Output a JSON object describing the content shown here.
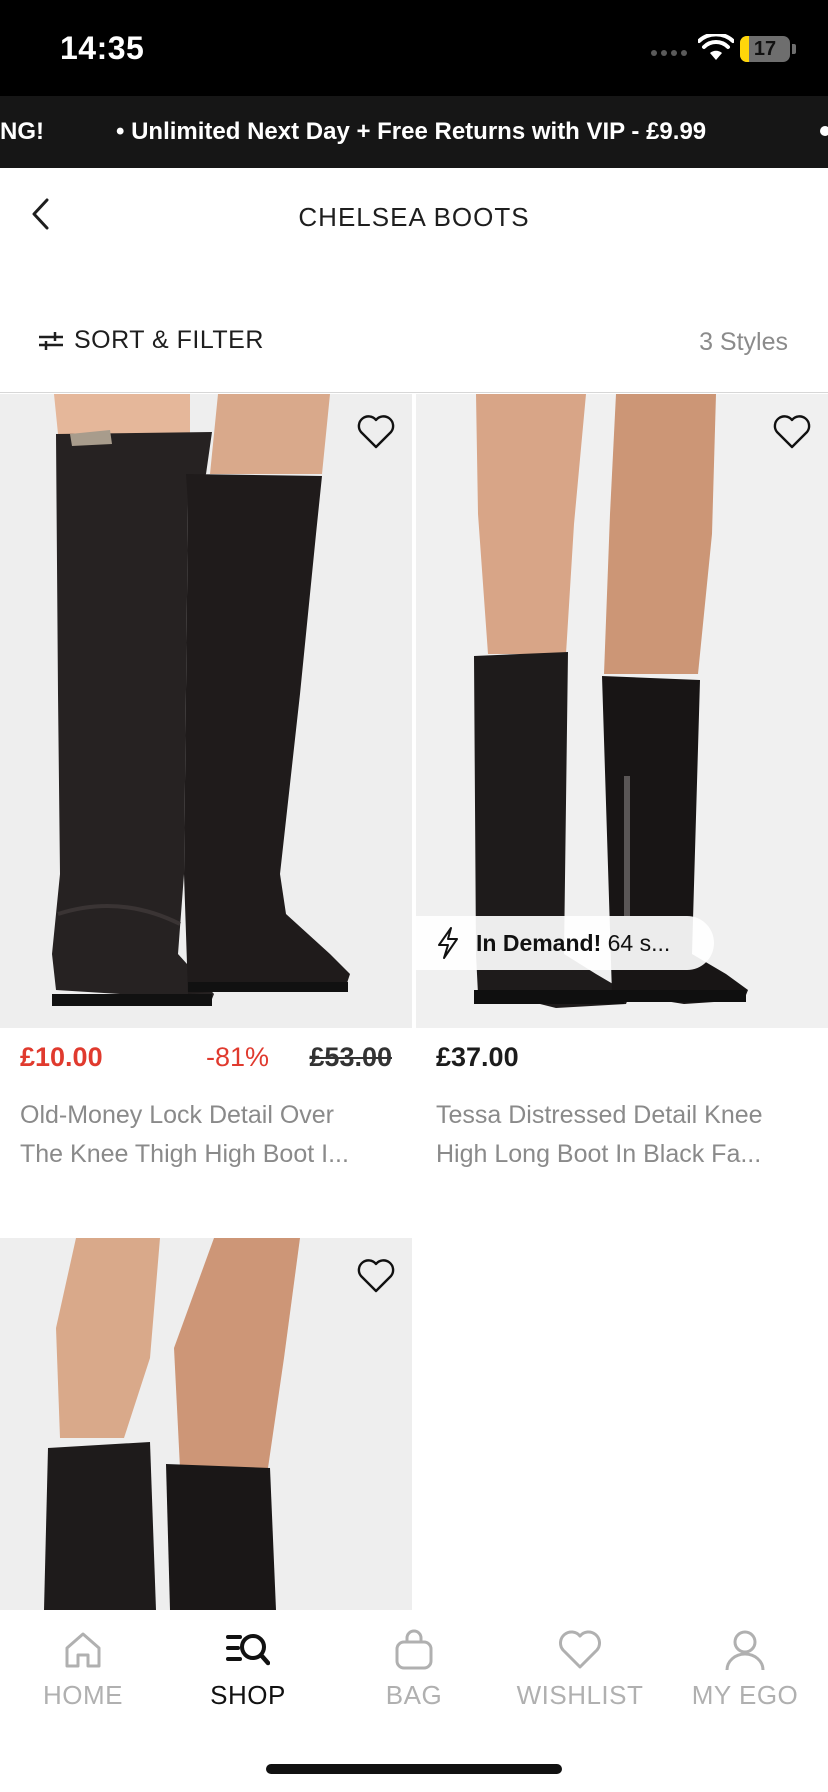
{
  "status_bar": {
    "time": "14:35",
    "battery": "17",
    "battery_level": 0.17
  },
  "promo": {
    "left_fragment": "NG!",
    "message": "• Unlimited Next Day + Free Returns with VIP - £9.99"
  },
  "header": {
    "title": "CHELSEA BOOTS",
    "back_icon": "chevron-left-icon"
  },
  "filter": {
    "label": "SORT & FILTER",
    "icon": "sliders-icon",
    "count": "3 Styles"
  },
  "products": [
    {
      "price": "£10.00",
      "discount": "-81%",
      "was_price": "£53.00",
      "name_line1": "Old-Money Lock Detail Over",
      "name_line2": "The Knee Thigh High Boot I...",
      "wishlist_icon": "heart-icon"
    },
    {
      "price": "£37.00",
      "badge_strong": "In Demand!",
      "badge_text": "64 s...",
      "badge_icon": "lightning-icon",
      "name_line1": "Tessa Distressed Detail Knee",
      "name_line2": "High Long Boot In Black Fa...",
      "wishlist_icon": "heart-icon"
    },
    {
      "wishlist_icon": "heart-icon"
    }
  ],
  "nav": {
    "items": [
      {
        "label": "HOME",
        "icon": "home-icon",
        "active": false
      },
      {
        "label": "SHOP",
        "icon": "search-list-icon",
        "active": true
      },
      {
        "label": "BAG",
        "icon": "bag-icon",
        "active": false
      },
      {
        "label": "WISHLIST",
        "icon": "heart-icon",
        "active": false
      },
      {
        "label": "MY EGO",
        "icon": "user-icon",
        "active": false
      }
    ]
  },
  "colors": {
    "sale": "#e03a2e",
    "promo_bg": "#161616",
    "inactive_nav": "#b0b0b0",
    "image_bg": "#efefef"
  }
}
